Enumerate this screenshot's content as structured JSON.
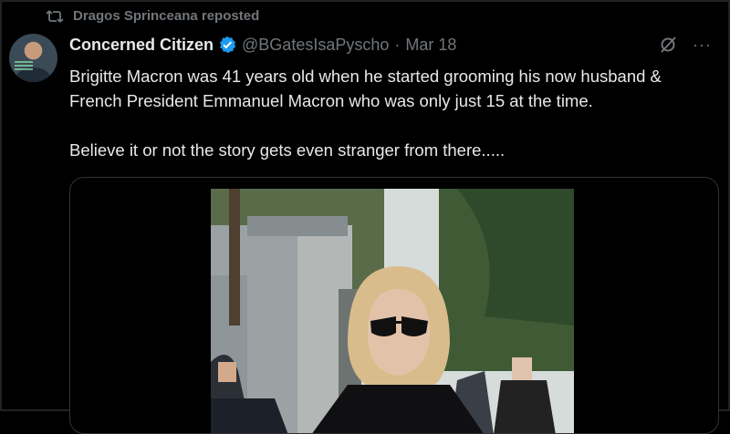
{
  "repost": {
    "label": "Dragos Sprinceana reposted",
    "icon": "repost-icon"
  },
  "post": {
    "author_name": "Concerned Citizen",
    "verified": true,
    "handle": "@BGatesIsaPyscho",
    "separator": "·",
    "date": "Mar 18",
    "paragraphs": [
      "Brigitte Macron was 41 years old when he started grooming his now husband & French President Emmanuel Macron who was only just 15 at the time.",
      "Believe it or not the story gets even stranger from there....."
    ]
  },
  "icons": {
    "verified": "verified-badge-icon",
    "grok": "grok-icon",
    "more": "more-icon"
  },
  "colors": {
    "background": "#000000",
    "text": "#e7e9ea",
    "muted": "#71767b",
    "verified": "#1d9bf0",
    "card_border": "#2f3336"
  }
}
